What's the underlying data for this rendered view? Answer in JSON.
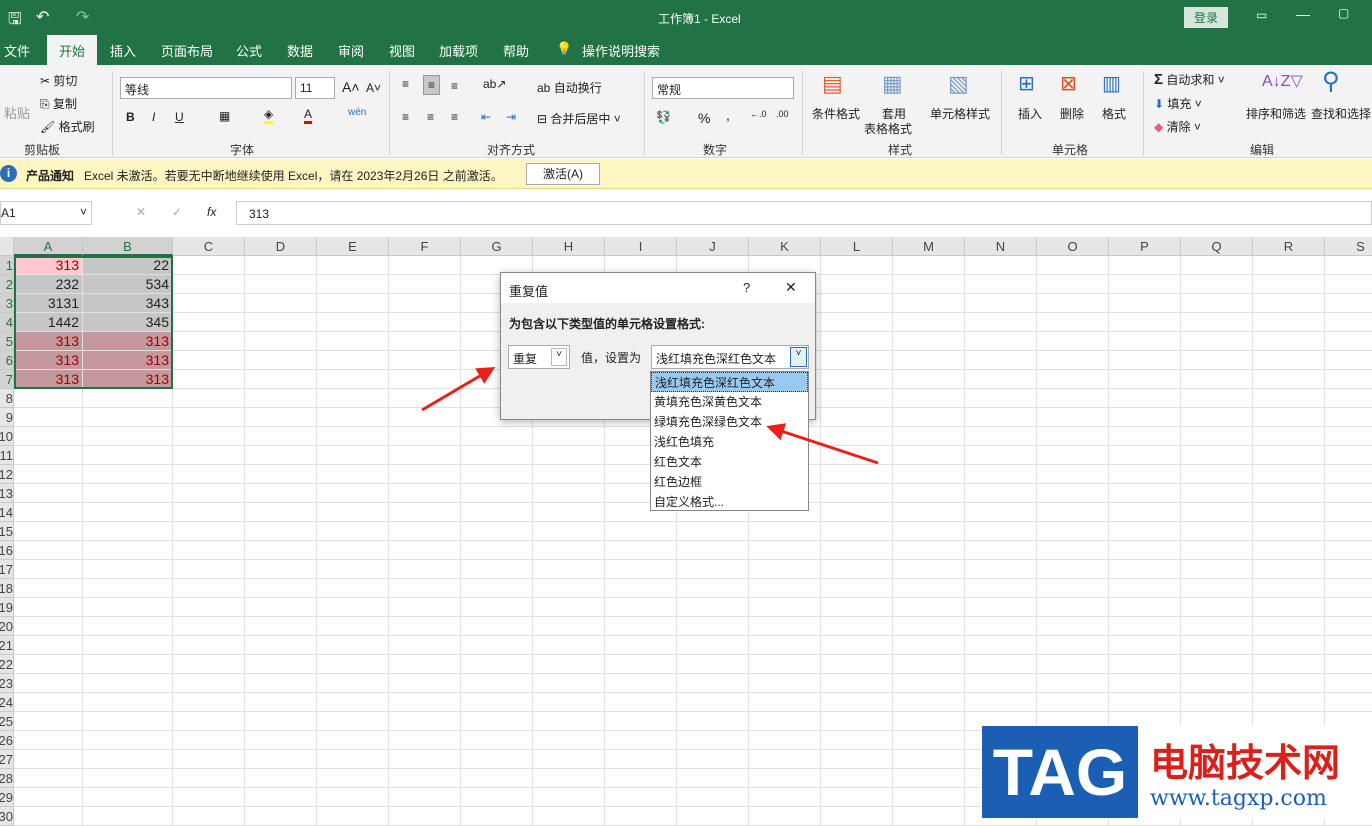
{
  "title": "工作簿1 - Excel",
  "login": "登录",
  "tabs": [
    "文件",
    "开始",
    "插入",
    "页面布局",
    "公式",
    "数据",
    "审阅",
    "视图",
    "加载项",
    "帮助",
    "操作说明搜索"
  ],
  "ribbon": {
    "paste": "粘贴",
    "cut": "剪切",
    "copy": "复制",
    "format_painter": "格式刷",
    "clipboard": "剪贴板",
    "font_name": "等线",
    "font_size": "11",
    "font": "字体",
    "wrap": "自动换行",
    "merge": "合并后居中",
    "align": "对齐方式",
    "number_format": "常规",
    "number": "数字",
    "cond_format": "条件格式",
    "table_format_1": "套用",
    "table_format_2": "表格格式",
    "cell_styles": "单元格样式",
    "styles": "样式",
    "insert": "插入",
    "delete": "删除",
    "format": "格式",
    "cells": "单元格",
    "autosum": "自动求和",
    "fill": "填充",
    "clear": "清除",
    "sort": "排序和筛选",
    "find": "查找和选择",
    "editing": "编辑",
    "bold": "B",
    "italic": "I",
    "underline": "U",
    "percent": "%",
    "comma": ","
  },
  "notice": {
    "label": "产品通知",
    "text": "Excel 未激活。若要无中断地继续使用 Excel，请在 2023年2月26日 之前激活。",
    "button": "激活(A)"
  },
  "formula": {
    "name_box": "A1",
    "fx": "fx",
    "value": "313"
  },
  "columns": [
    "A",
    "B",
    "C",
    "D",
    "E",
    "F",
    "G",
    "H",
    "I",
    "J",
    "K",
    "L",
    "M",
    "N",
    "O",
    "P",
    "Q",
    "R",
    "S"
  ],
  "cells": [
    [
      "313",
      "22"
    ],
    [
      "232",
      "534"
    ],
    [
      "3131",
      "343"
    ],
    [
      "1442",
      "345"
    ],
    [
      "313",
      "313"
    ],
    [
      "313",
      "313"
    ],
    [
      "313",
      "313"
    ]
  ],
  "dialog": {
    "title": "重复值",
    "help": "?",
    "close": "✕",
    "label": "为包含以下类型值的单元格设置格式:",
    "type": "重复",
    "mid": "值，设置为",
    "selected": "浅红填充色深红色文本",
    "options": [
      "浅红填充色深红色文本",
      "黄填充色深黄色文本",
      "绿填充色深绿色文本",
      "浅红色填充",
      "红色文本",
      "红色边框",
      "自定义格式..."
    ]
  },
  "watermark": {
    "logo": "TAG",
    "name": "电脑技术网",
    "url": "www.tagxp.com"
  }
}
